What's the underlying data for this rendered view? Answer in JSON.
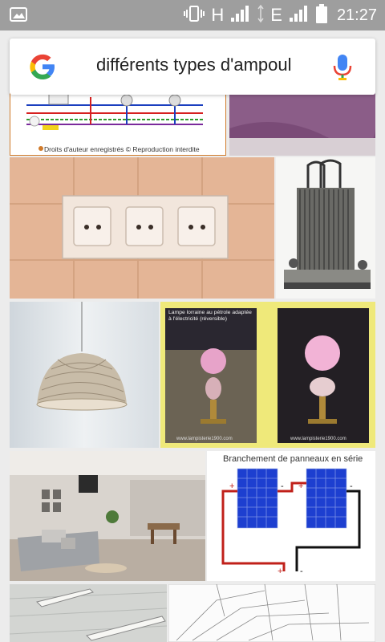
{
  "status_bar": {
    "network_h": "H",
    "network_e": "E",
    "time": "21:27"
  },
  "search": {
    "query": "différents types d'ampoul"
  },
  "results": {
    "wiring_copyright": "Droits d'auteur enregistrés © Reproduction interdite",
    "lamp_caption": "Lampe lorraine au pétrole adaptée à l'électricité (réversible)",
    "lamp_url_left": "www.lampisterie1900.com",
    "lamp_url_right": "www.lampisterie1900.com",
    "solar_title": "Branchement de panneaux en série",
    "solar_plus_1": "+",
    "solar_minus_1": "-",
    "solar_plus_2": "+",
    "solar_minus_2": "-",
    "solar_out_plus": "+",
    "solar_out_minus": "-"
  }
}
